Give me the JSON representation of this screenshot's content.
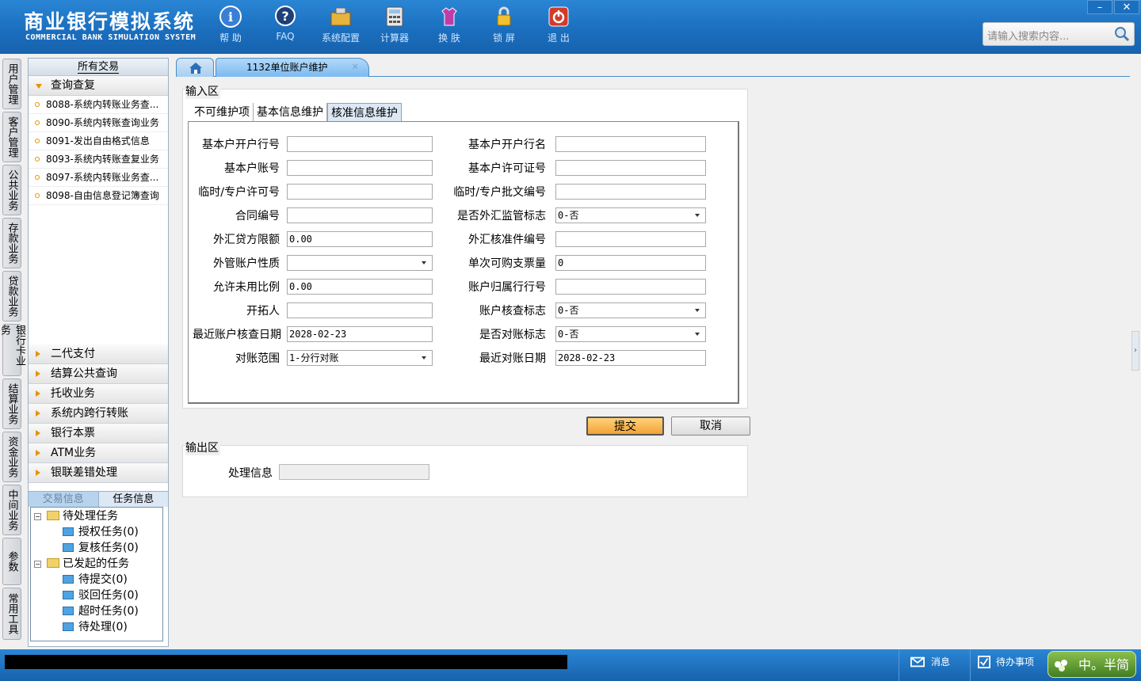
{
  "header": {
    "title_cn": "商业银行模拟系统",
    "title_en": "COMMERCIAL BANK SIMULATION SYSTEM",
    "toolbar": [
      {
        "label": "帮 助",
        "icon": "help-icon"
      },
      {
        "label": "FAQ",
        "icon": "faq-icon"
      },
      {
        "label": "系统配置",
        "icon": "system-config-icon"
      },
      {
        "label": "计算器",
        "icon": "calculator-icon"
      },
      {
        "label": "换 肤",
        "icon": "skin-icon"
      },
      {
        "label": "锁 屏",
        "icon": "lock-icon"
      },
      {
        "label": "退 出",
        "icon": "exit-icon"
      }
    ],
    "window_controls": {
      "minimize": "–",
      "close": "✕"
    },
    "search_placeholder": "请输入搜索内容..."
  },
  "left_tabs": [
    "用户管理",
    "客户管理",
    "公共业务",
    "存款业务",
    "贷款业务",
    "银行卡业务",
    "结算业务",
    "资金业务",
    "中间业务",
    "参数",
    "常用工具"
  ],
  "sidebar": {
    "header": "所有交易",
    "expanded_category": "查询查复",
    "transactions": [
      "8088-系统内转账业务查...",
      "8090-系统内转账查询业务",
      "8091-发出自由格式信息",
      "8093-系统内转账查复业务",
      "8097-系统内转账业务查...",
      "8098-自由信息登记簿查询"
    ],
    "categories": [
      "二代支付",
      "结算公共查询",
      "托收业务",
      "系统内跨行转账",
      "银行本票",
      "ATM业务",
      "银联差错处理"
    ],
    "bottom_tabs": {
      "inactive": "交易信息",
      "active": "任务信息"
    },
    "tree": {
      "pending": {
        "label": "待处理任务",
        "children": [
          "授权任务(0)",
          "复核任务(0)"
        ]
      },
      "initiated": {
        "label": "已发起的任务",
        "children": [
          "待提交(0)",
          "驳回任务(0)",
          "超时任务(0)",
          "待处理(0)"
        ]
      }
    }
  },
  "main": {
    "tab_title": "1132单位账户维护",
    "input_area_label": "输入区",
    "output_area_label": "输出区",
    "form_tabs": [
      "不可维护项",
      "基本信息维护",
      "核准信息维护"
    ],
    "active_form_tab": "核准信息维护",
    "left_fields": [
      {
        "label": "基本户开户行号",
        "value": "",
        "type": "text"
      },
      {
        "label": "基本户账号",
        "value": "",
        "type": "text"
      },
      {
        "label": "临时/专户许可号",
        "value": "",
        "type": "text"
      },
      {
        "label": "合同编号",
        "value": "",
        "type": "text"
      },
      {
        "label": "外汇贷方限额",
        "value": "0.00",
        "type": "text"
      },
      {
        "label": "外管账户性质",
        "value": "",
        "type": "select"
      },
      {
        "label": "允许未用比例",
        "value": "0.00",
        "type": "text"
      },
      {
        "label": "开拓人",
        "value": "",
        "type": "text"
      },
      {
        "label": "最近账户核查日期",
        "value": "2028-02-23",
        "type": "text"
      },
      {
        "label": "对账范围",
        "value": "1-分行对账",
        "type": "select"
      }
    ],
    "right_fields": [
      {
        "label": "基本户开户行名",
        "value": "",
        "type": "text"
      },
      {
        "label": "基本户许可证号",
        "value": "",
        "type": "text"
      },
      {
        "label": "临时/专户批文编号",
        "value": "",
        "type": "text"
      },
      {
        "label": "是否外汇监管标志",
        "value": "0-否",
        "type": "select"
      },
      {
        "label": "外汇核准件编号",
        "value": "",
        "type": "text"
      },
      {
        "label": "单次可购支票量",
        "value": "0",
        "type": "text"
      },
      {
        "label": "账户归属行行号",
        "value": "",
        "type": "text"
      },
      {
        "label": "账户核查标志",
        "value": "0-否",
        "type": "select"
      },
      {
        "label": "是否对账标志",
        "value": "0-否",
        "type": "select"
      },
      {
        "label": "最近对账日期",
        "value": "2028-02-23",
        "type": "text"
      }
    ],
    "submit_label": "提交",
    "cancel_label": "取消",
    "process_info_label": "处理信息",
    "process_info_value": ""
  },
  "statusbar": {
    "message_label": "消息",
    "todo_label": "待办事项",
    "brand": "中。半简"
  },
  "colors": {
    "header_blue": "#1b6fbf",
    "accent_orange": "#e69200",
    "tab_blue": "#7cbaf0"
  }
}
